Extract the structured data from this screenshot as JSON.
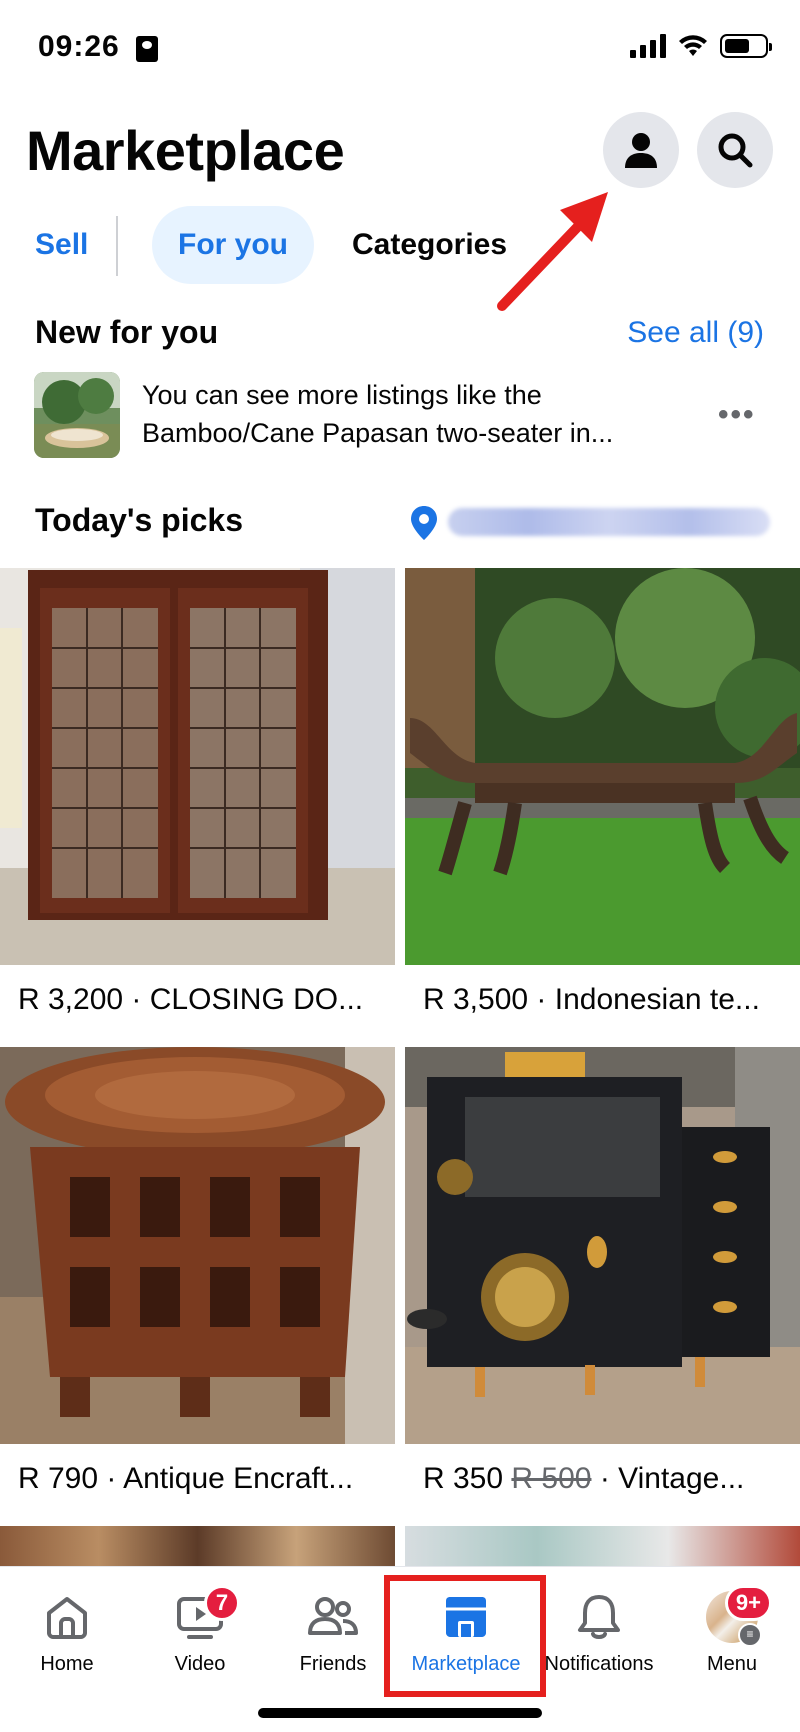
{
  "status_bar": {
    "time": "09:26"
  },
  "header": {
    "title": "Marketplace",
    "profile_icon": "person-icon",
    "search_icon": "search-icon"
  },
  "tabs": {
    "sell": "Sell",
    "for_you": "For you",
    "categories": "Categories"
  },
  "new_for_you": {
    "title": "New for you",
    "see_all": "See all (9)",
    "listing_text": "You can see more listings like the Bamboo/Cane Papasan two-seater in..."
  },
  "todays_picks": {
    "title": "Today's picks"
  },
  "listings": [
    {
      "price": "R 3,200",
      "title": "CLOSING DO..."
    },
    {
      "price": "R 3,500",
      "title": "Indonesian te..."
    },
    {
      "price": "R 790",
      "title": "Antique Encraft..."
    },
    {
      "price": "R 350",
      "old_price": "R 500",
      "title": "Vintage..."
    }
  ],
  "separator": "·",
  "bottom_nav": {
    "home": "Home",
    "video": "Video",
    "video_badge": "7",
    "friends": "Friends",
    "marketplace": "Marketplace",
    "notifications": "Notifications",
    "menu": "Menu",
    "menu_badge": "9+"
  },
  "colors": {
    "accent": "#1b74e4",
    "highlight_red": "#e5201e",
    "badge_red": "#e41e3f"
  }
}
